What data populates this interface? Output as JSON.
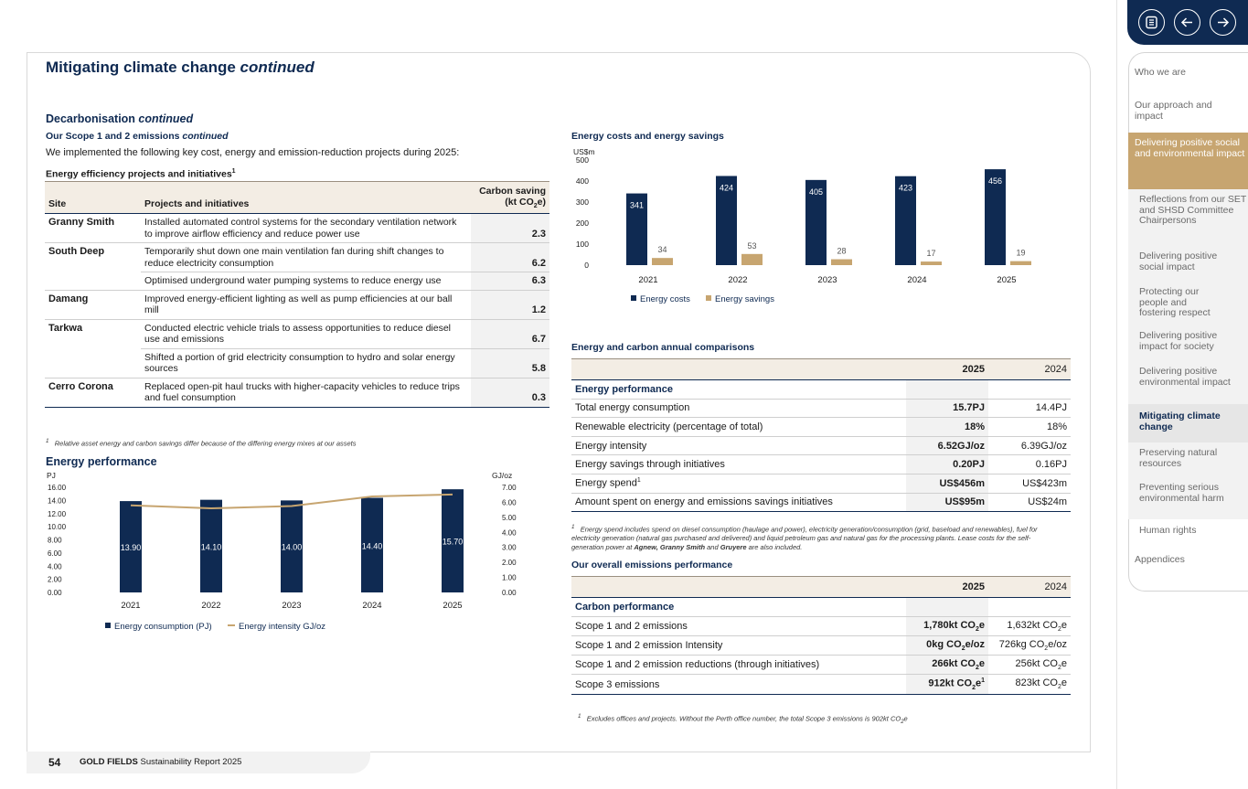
{
  "page": {
    "title": "Mitigating climate change",
    "title_suffix": "continued",
    "page_number": "54",
    "brand": "GOLD FIELDS",
    "report": "Sustainability Report 2025"
  },
  "left": {
    "section_heading": "Decarbonisation",
    "section_suffix": "continued",
    "sub_heading": "Our Scope 1 and 2 emissions",
    "sub_suffix": "continued",
    "intro": "We implemented the following key cost, energy and emission-reduction projects during 2025:",
    "table_title": "Energy efficiency projects and initiatives",
    "table_title_sup": "1",
    "columns": [
      "Site",
      "Projects and initiatives",
      "Carbon saving",
      "(kt CO",
      "2",
      "e)"
    ],
    "rows": [
      {
        "site": "Granny Smith",
        "project": "Installed automated control systems for the secondary ventilation network to improve airflow efficiency and reduce power use",
        "value": "2.3"
      },
      {
        "site": "South Deep",
        "project": "Temporarily shut down one main ventilation fan during shift changes to reduce electricity consumption",
        "value": "6.2"
      },
      {
        "site": "",
        "project": "Optimised underground water pumping systems to reduce energy use",
        "value": "6.3"
      },
      {
        "site": "Damang",
        "project": "Improved energy-efficient lighting as well as pump efficiencies at our ball mill",
        "value": "1.2"
      },
      {
        "site": "Tarkwa",
        "project": "Conducted electric vehicle trials to assess opportunities to reduce diesel use and emissions",
        "value": "6.7"
      },
      {
        "site": "",
        "project": "Shifted a portion of grid electricity consumption to hydro and solar energy sources",
        "value": "5.8"
      },
      {
        "site": "Cerro Corona",
        "project": "Replaced open-pit haul trucks with higher-capacity vehicles to reduce trips and fuel consumption",
        "value": "0.3"
      }
    ],
    "footnote_mark": "1",
    "footnote": "Relative asset energy and carbon savings differ because of the differing energy mixes at our assets"
  },
  "chart_data": [
    {
      "type": "bar",
      "title": "Energy performance",
      "ylabel": "PJ",
      "y2label": "GJ/oz",
      "categories": [
        "2021",
        "2022",
        "2023",
        "2024",
        "2025"
      ],
      "series": [
        {
          "name": "Energy consumption (PJ)",
          "values": [
            13.9,
            14.1,
            14.0,
            14.4,
            15.7
          ],
          "labels": [
            "13.90",
            "14.10",
            "14.00",
            "14.40",
            "15.70"
          ],
          "color": "#0f2a52"
        },
        {
          "name": "Energy intensity GJ/oz",
          "type": "line",
          "axis": "right",
          "values": [
            5.8,
            5.6,
            5.75,
            6.39,
            6.52
          ],
          "color": "#c7a570"
        }
      ],
      "ylim": [
        0,
        16
      ],
      "y2lim": [
        0,
        7
      ],
      "yticks": [
        "0.00",
        "2.00",
        "4.00",
        "6.00",
        "8.00",
        "10.00",
        "12.00",
        "14.00",
        "16.00"
      ],
      "y2ticks": [
        "0.00",
        "1.00",
        "2.00",
        "3.00",
        "4.00",
        "5.00",
        "6.00",
        "7.00"
      ],
      "legend": "bottom"
    },
    {
      "type": "bar",
      "title": "Energy costs and energy savings",
      "ylabel": "US$m",
      "categories": [
        "2021",
        "2022",
        "2023",
        "2024",
        "2025"
      ],
      "series": [
        {
          "name": "Energy costs",
          "values": [
            341,
            424,
            405,
            423,
            456
          ],
          "color": "#0f2a52"
        },
        {
          "name": "Energy savings",
          "values": [
            34,
            53,
            28,
            17,
            19
          ],
          "color": "#c7a570"
        }
      ],
      "ylim": [
        0,
        500
      ],
      "yticks": [
        "0",
        "100",
        "200",
        "300",
        "400",
        "500"
      ],
      "legend": "bottom"
    }
  ],
  "comparisons": {
    "title": "Energy and carbon annual comparisons",
    "col_2025": "2025",
    "col_2024": "2024",
    "section": "Energy performance",
    "rows": [
      {
        "label": "Total energy consumption",
        "v2025": "15.7PJ",
        "v2024": "14.4PJ"
      },
      {
        "label": "Renewable electricity (percentage of total)",
        "v2025": "18%",
        "v2024": "18%"
      },
      {
        "label": "Energy intensity",
        "v2025": "6.52GJ/oz",
        "v2024": "6.39GJ/oz"
      },
      {
        "label": "Energy savings through initiatives",
        "v2025": "0.20PJ",
        "v2024": "0.16PJ"
      },
      {
        "label": "Energy spend",
        "sup": "1",
        "v2025": "US$456m",
        "v2024": "US$423m"
      },
      {
        "label": "Amount spent on energy and emissions savings initiatives",
        "v2025": "US$95m",
        "v2024": "US$24m"
      }
    ],
    "footnote_mark": "1",
    "footnote_a": "Energy spend includes spend on diesel consumption (haulage and power), electricity generation/consumption (grid, baseload and renewables), fuel for electricity generation (natural gas purchased and delivered) and liquid petroleum gas and natural gas for the processing plants. Lease costs for the self-generation power at ",
    "footnote_b": "Agnew, Granny Smith",
    "footnote_c": " and ",
    "footnote_d": "Gruyere",
    "footnote_e": " are also included."
  },
  "emissions": {
    "title": "Our overall emissions performance",
    "col_2025": "2025",
    "col_2024": "2024",
    "section": "Carbon performance",
    "rows": [
      {
        "label": "Scope 1 and 2 emissions",
        "v2025a": "1,780kt CO",
        "v2025b": "e",
        "v2024a": "1,632kt CO",
        "v2024b": "e"
      },
      {
        "label": "Scope 1 and 2 emission Intensity",
        "v2025a": "0kg CO",
        "v2025b": "e/oz",
        "v2024a": "726kg CO",
        "v2024b": "e/oz"
      },
      {
        "label": "Scope 1 and 2 emission reductions (through initiatives)",
        "v2025a": "266kt CO",
        "v2025b": "e",
        "v2024a": "256kt CO",
        "v2024b": "e"
      },
      {
        "label": "Scope 3 emissions",
        "v2025a": "912kt CO",
        "v2025b": "e",
        "v2025sup": "1",
        "v2024a": "823kt CO",
        "v2024b": "e"
      }
    ],
    "sub2": "2",
    "footnote_mark": "1",
    "footnote": "Excludes offices and projects. Without the Perth office number, the total Scope 3 emissions is 902kt CO",
    "footnote_end": "e"
  },
  "sidebar": {
    "nav_icons": [
      "contents-icon",
      "arrow-left-icon",
      "arrow-right-icon"
    ],
    "items": [
      {
        "label": "Who we are"
      },
      {
        "label": "Our approach and impact"
      },
      {
        "label": "Delivering positive social and environmental impact"
      },
      {
        "label": "Reflections from our SET and SHSD Committee Chairpersons"
      },
      {
        "label": "Delivering positive social impact"
      },
      {
        "label": "Protecting our people and fostering respect"
      },
      {
        "label": "Delivering positive impact for society"
      },
      {
        "label": "Delivering positive environmental impact"
      },
      {
        "label": "Mitigating climate change"
      },
      {
        "label": "Preserving natural resources"
      },
      {
        "label": "Preventing serious environmental harm"
      },
      {
        "label": "Human rights"
      },
      {
        "label": "Appendices"
      }
    ]
  },
  "colors": {
    "navy": "#0f2a52",
    "gold": "#c7a570"
  }
}
